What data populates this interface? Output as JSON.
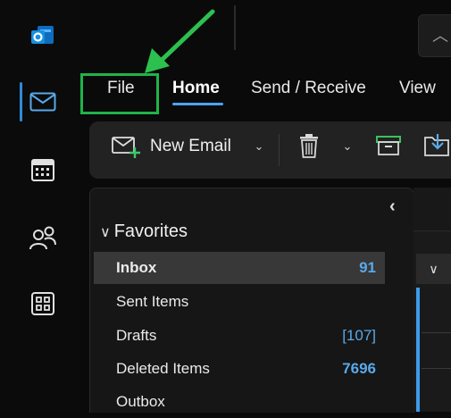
{
  "colors": {
    "accent": "#4aa3ff",
    "highlight": "#1fb34a",
    "count": "#5aa9ea"
  },
  "rail": {
    "icons": [
      "outlook-logo-icon",
      "mail-icon",
      "calendar-icon",
      "people-icon",
      "apps-icon"
    ],
    "active": "mail-icon"
  },
  "tabs": {
    "file": "File",
    "home": "Home",
    "send_receive": "Send / Receive",
    "view": "View"
  },
  "ribbon": {
    "new_email": "New Email"
  },
  "folders": {
    "favorites_label": "Favorites",
    "items": [
      {
        "label": "Inbox",
        "count": "91",
        "selected": true
      },
      {
        "label": "Sent Items",
        "count": ""
      },
      {
        "label": "Drafts",
        "count": "[107]"
      },
      {
        "label": "Deleted Items",
        "count": "7696"
      },
      {
        "label": "Outbox",
        "count": ""
      }
    ]
  }
}
